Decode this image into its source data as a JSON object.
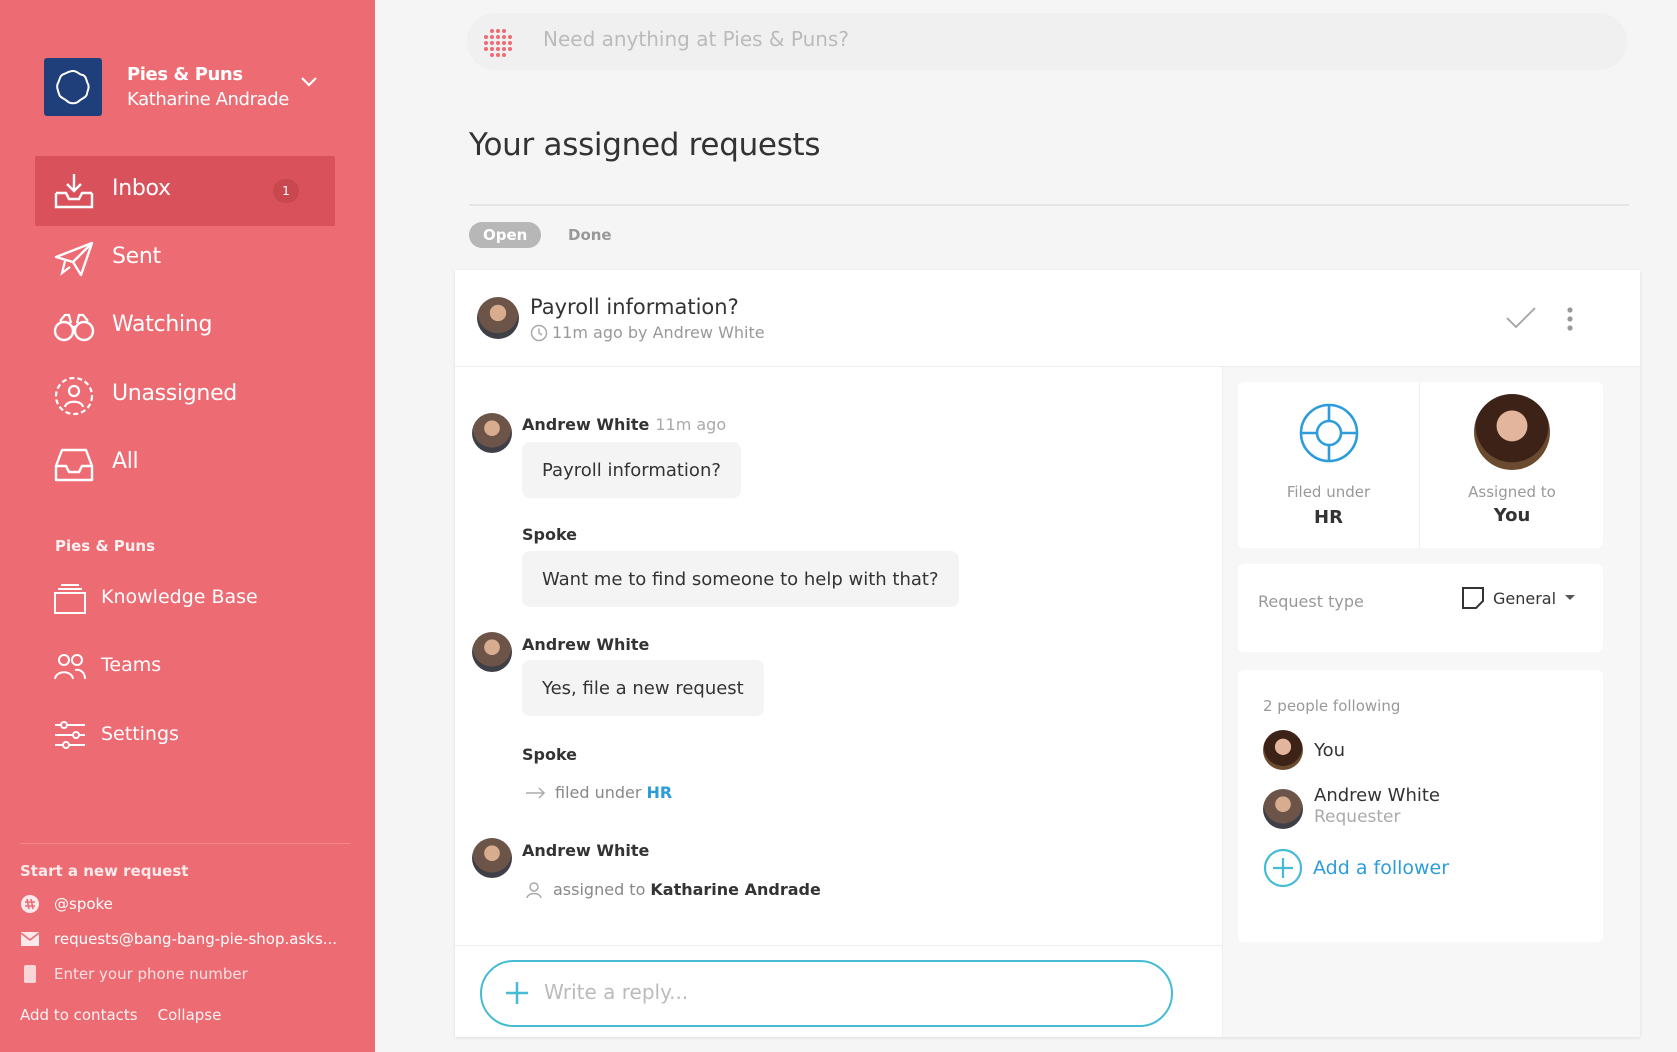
{
  "workspace": {
    "name": "Pies & Puns",
    "user": "Katharine Andrade"
  },
  "nav": [
    {
      "label": "Inbox",
      "badge": "1",
      "active": true,
      "icon": "inbox-icon"
    },
    {
      "label": "Sent",
      "icon": "paper-plane-icon"
    },
    {
      "label": "Watching",
      "icon": "binoculars-icon"
    },
    {
      "label": "Unassigned",
      "icon": "unassigned-user-icon"
    },
    {
      "label": "All",
      "icon": "tray-icon"
    }
  ],
  "section_label": "Pies & Puns",
  "nav2": [
    {
      "label": "Knowledge Base",
      "icon": "knowledge-base-icon"
    },
    {
      "label": "Teams",
      "icon": "teams-icon"
    },
    {
      "label": "Settings",
      "icon": "sliders-icon"
    }
  ],
  "start_request": {
    "title": "Start a new request",
    "slack": "@spoke",
    "email": "requests@bang-bang-pie-shop.asks...",
    "phone_placeholder": "Enter your phone number",
    "add_to_contacts": "Add to contacts",
    "collapse": "Collapse"
  },
  "search": {
    "placeholder": "Need anything at Pies & Puns?"
  },
  "page": {
    "title": "Your assigned requests",
    "tabs": [
      {
        "label": "Open",
        "active": true
      },
      {
        "label": "Done"
      }
    ]
  },
  "request": {
    "title": "Payroll information?",
    "meta": "11m ago by Andrew White",
    "messages": [
      {
        "type": "user",
        "author": "Andrew White",
        "time": "11m ago",
        "text": "Payroll information?"
      },
      {
        "type": "bot",
        "author": "Spoke",
        "text": "Want me to find someone to help with that?"
      },
      {
        "type": "user",
        "author": "Andrew White",
        "text": "Yes, file a new request"
      },
      {
        "type": "bot",
        "author": "Spoke",
        "system": {
          "prefix": "filed under",
          "link": "HR"
        }
      },
      {
        "type": "user",
        "author": "Andrew White",
        "system": {
          "prefix": "assigned to",
          "target": "Katharine Andrade"
        }
      }
    ],
    "reply_placeholder": "Write a reply..."
  },
  "details": {
    "filed_under": {
      "caption": "Filed under",
      "value": "HR"
    },
    "assigned_to": {
      "caption": "Assigned to",
      "value": "You"
    },
    "request_type": {
      "label": "Request type",
      "value": "General"
    },
    "following": {
      "count_label": "2 people following",
      "people": [
        {
          "name": "You",
          "role": ""
        },
        {
          "name": "Andrew White",
          "role": "Requester"
        }
      ],
      "add_label": "Add a follower"
    }
  },
  "colors": {
    "sidebar": "#ed6b73",
    "sidebar_active": "#d9525b",
    "accent": "#45bcd3",
    "link": "#2d9cdb"
  }
}
